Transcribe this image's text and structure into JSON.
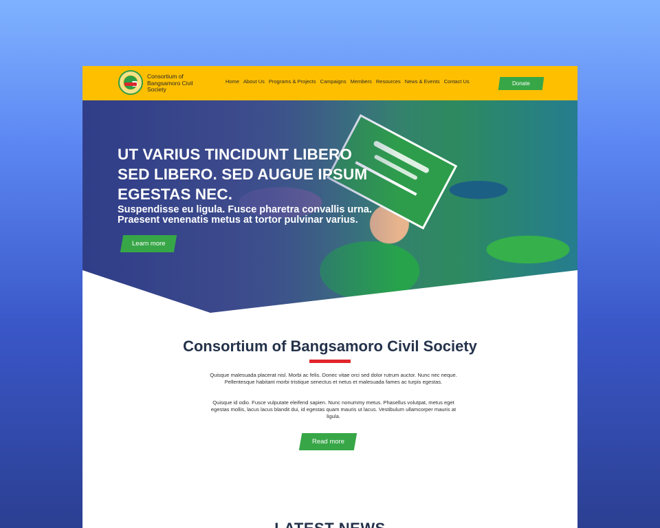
{
  "header": {
    "org_name": "Consortium of Bangsamoro Civil Society",
    "nav": [
      "Home",
      "About Us",
      "Programs & Projects",
      "Campaigns",
      "Members",
      "Resources",
      "News & Events",
      "Contact Us"
    ],
    "donate_label": "Donate"
  },
  "hero": {
    "title": "UT VARIUS TINCIDUNT LIBERO SED LIBERO. SED AUGUE IPSUM EGESTAS NEC.",
    "subtitle": "Suspendisse eu ligula. Fusce pharetra convallis urna. Praesent venenatis metus at tortor pulvinar varius.",
    "cta_label": "Learn more"
  },
  "about": {
    "title": "Consortium of Bangsamoro Civil Society",
    "paragraph_1": "Quisque malesuada placerat nisl. Morbi ac felis. Donec vitae orci sed dolor rutrum auctor. Nunc nec neque. Pellentesque habitant morbi tristique senectus et netus et malesuada fames ac turpis egestas.",
    "paragraph_2": "Quisque id odio. Fusce vulputate eleifend sapien. Nunc nonummy metus. Phasellus volutpat, metus eget egestas mollis, lacus lacus blandit dui, id egestas quam mauris ut lacus. Vestibulum ullamcorper mauris at ligula.",
    "cta_label": "Read more"
  },
  "news": {
    "title": "LATEST NEWS"
  },
  "colors": {
    "header_bg": "#fdbf00",
    "button_green": "#37a647",
    "accent_red": "#e0262c",
    "heading_navy": "#24324a",
    "outer_bg_top": "#7fb2ff",
    "outer_bg_bottom": "#2b3f91"
  }
}
